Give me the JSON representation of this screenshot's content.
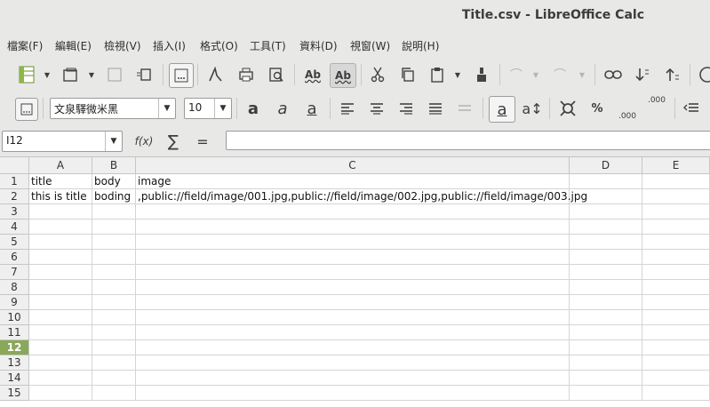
{
  "window": {
    "title": "Title.csv - LibreOffice Calc"
  },
  "menu": [
    "檔案(F)",
    "編輯(E)",
    "檢視(V)",
    "插入(I)",
    "格式(O)",
    "工具(T)",
    "資料(D)",
    "視窗(W)",
    "說明(H)"
  ],
  "toolbar_standard": {
    "spellcheck_label": "Ab",
    "autospell_label": "Ab"
  },
  "toolbar_format": {
    "font_name": "文泉驛微米黑",
    "font_size": "10",
    "percent_label": "%",
    "number_format_label": ".000",
    "add_decimal_label": ".000",
    "bold_label": "a",
    "italic_label": "a",
    "underline_label": "a"
  },
  "formula_bar": {
    "name_box": "I12",
    "function_wizard_label": "f(x)",
    "sum_label": "∑",
    "equals_label": "=",
    "input": ""
  },
  "sheet": {
    "columns": [
      "A",
      "B",
      "C",
      "D",
      "E"
    ],
    "rows": [
      "1",
      "2",
      "3",
      "4",
      "5",
      "6",
      "7",
      "8",
      "9",
      "10",
      "11",
      "12",
      "13",
      "14",
      "15"
    ],
    "selected_row": "12",
    "cells": {
      "A1": "title",
      "B1": "body",
      "C1": "image",
      "A2": "this is title",
      "B2": "boding",
      "C2": ",public://field/image/001.jpg,public://field/image/002.jpg,public://field/image/003.jpg"
    }
  }
}
